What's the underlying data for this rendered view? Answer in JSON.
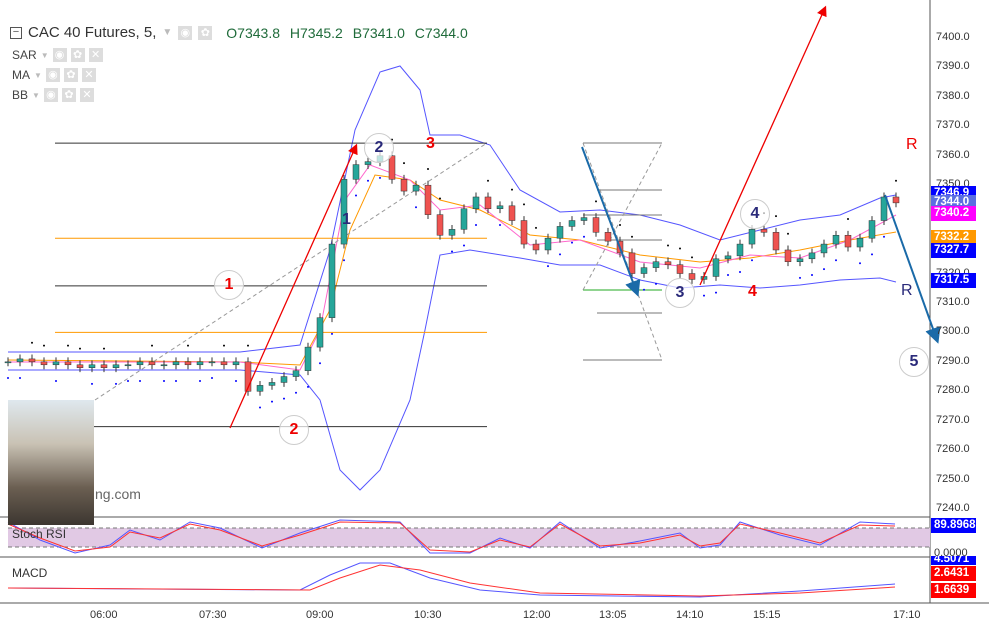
{
  "header": {
    "symbol": "CAC 40 Futures, 5,",
    "open": "O7343.8",
    "high": "H7345.2",
    "bid": "B7341.0",
    "close": "C7344.0"
  },
  "indicators": [
    {
      "label": "SAR"
    },
    {
      "label": "MA"
    },
    {
      "label": "BB"
    }
  ],
  "panes": {
    "stoch_label": "Stoch RSI",
    "macd_label": "MACD",
    "stoch_value": "89.8968",
    "stoch_zero": "0.0000",
    "macd_values": [
      "4.5071",
      "2.6431",
      "1.6639"
    ]
  },
  "watermark": "ng.com",
  "price_tags": [
    {
      "value": "7346.9",
      "color": "#0000ff"
    },
    {
      "value": "7344.0",
      "color": "#5b6ee1"
    },
    {
      "value": "7340.2",
      "color": "#ff00ff"
    },
    {
      "value": "7332.2",
      "color": "#ff9900"
    },
    {
      "value": "7327.7",
      "color": "#0000ff"
    },
    {
      "value": "7317.5",
      "color": "#0000ff"
    }
  ],
  "annotations": {
    "red": [
      "1",
      "2",
      "3",
      "4"
    ],
    "blue": [
      "1",
      "2",
      "3",
      "4",
      "5"
    ],
    "r_red": "R",
    "r_blue": "R"
  },
  "chart_data": {
    "type": "candlestick",
    "title": "CAC 40 Futures, 5",
    "y_ticks": [
      "7240.0",
      "7250.0",
      "7260.0",
      "7270.0",
      "7280.0",
      "7290.0",
      "7300.0",
      "7310.0",
      "7320.0",
      "7330.0",
      "7340.0",
      "7350.0",
      "7360.0",
      "7370.0",
      "7380.0",
      "7390.0",
      "7400.0"
    ],
    "ylim": [
      7240,
      7400
    ],
    "x_ticks": [
      "06:00",
      "07:30",
      "09:00",
      "10:30",
      "12:00",
      "13:05",
      "14:10",
      "15:15",
      "17:10"
    ],
    "closes": [
      7290,
      7291,
      7290,
      7289,
      7290,
      7289,
      7288,
      7289,
      7288,
      7289,
      7289,
      7290,
      7289,
      7289,
      7290,
      7289,
      7290,
      7290,
      7289,
      7290,
      7280,
      7282,
      7283,
      7285,
      7287,
      7295,
      7305,
      7330,
      7352,
      7357,
      7358,
      7360,
      7352,
      7348,
      7350,
      7340,
      7333,
      7335,
      7342,
      7346,
      7342,
      7343,
      7338,
      7330,
      7328,
      7332,
      7336,
      7338,
      7339,
      7334,
      7331,
      7327,
      7320,
      7322,
      7324,
      7323,
      7320,
      7318,
      7319,
      7325,
      7326,
      7330,
      7335,
      7334,
      7328,
      7324,
      7325,
      7327,
      7330,
      7333,
      7329,
      7332,
      7338,
      7346,
      7344
    ],
    "horizontal_levels": [
      {
        "price": 7364.3,
        "color": "#333333"
      },
      {
        "price": 7332.0,
        "color": "#ff9900"
      },
      {
        "price": 7315.8,
        "color": "#333333"
      },
      {
        "price": 7300.0,
        "color": "#ff9900"
      },
      {
        "price": 7268.0,
        "color": "#333333"
      }
    ],
    "up_color": "#26a69a",
    "down_color": "#ef5350"
  }
}
